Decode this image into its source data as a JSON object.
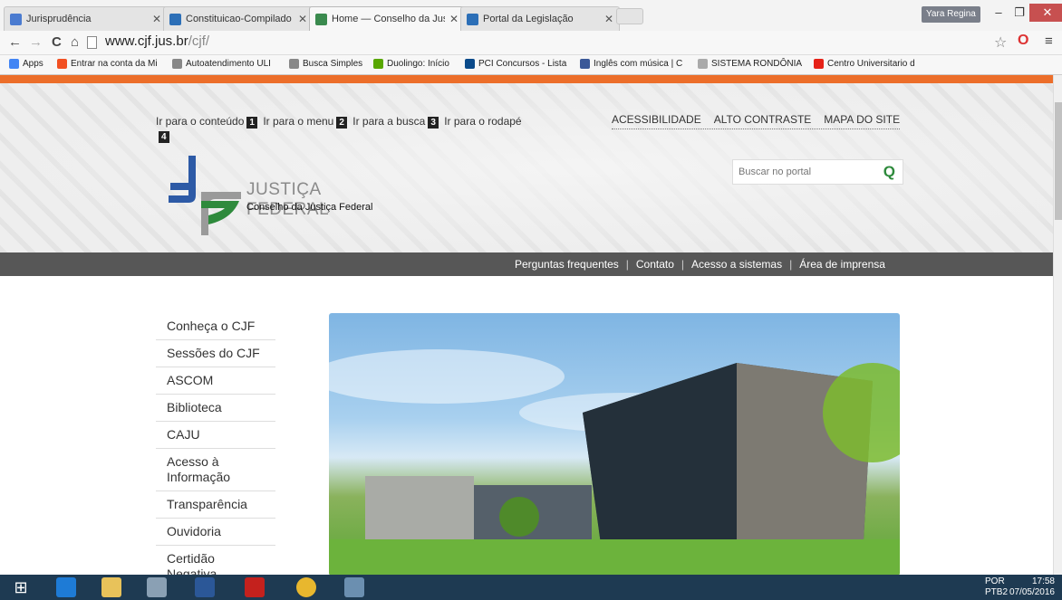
{
  "browser": {
    "tabs": [
      {
        "title": "Jurisprudência",
        "active": false,
        "color": "#4a7bd0"
      },
      {
        "title": "Constituicao-Compilado",
        "active": false,
        "color": "#2c6fb7"
      },
      {
        "title": "Home — Conselho da Jus",
        "active": true,
        "color": "#3a8a4e"
      },
      {
        "title": "Portal da Legislação",
        "active": false,
        "color": "#2c6fb7"
      }
    ],
    "user": "Yara Regina",
    "url_host": "www.cjf.jus.br",
    "url_path": "/cjf/",
    "bookmarks": [
      {
        "label": "Apps",
        "color": "#4285f4"
      },
      {
        "label": "Entrar na conta da Mi",
        "color": "#f25022"
      },
      {
        "label": "Autoatendimento ULI",
        "color": "#888888"
      },
      {
        "label": "Busca Simples",
        "color": "#888888"
      },
      {
        "label": "Duolingo: Início",
        "color": "#58a700"
      },
      {
        "label": "PCI Concursos - Lista",
        "color": "#0a4a8a"
      },
      {
        "label": "Inglês com música | C",
        "color": "#3b5998"
      },
      {
        "label": "SISTEMA RONDÔNIA",
        "color": "#aaaaaa"
      },
      {
        "label": "Centro Universitario d",
        "color": "#e62117"
      }
    ]
  },
  "page": {
    "skip": {
      "a": "Ir para o conteúdo",
      "ak": "1",
      "b": "Ir para o menu",
      "bk": "2",
      "c": "Ir para a busca",
      "ck": "3",
      "d": "Ir para o rodapé",
      "dk": "4"
    },
    "toplinks": [
      "ACESSIBILIDADE",
      "ALTO CONTRASTE",
      "MAPA DO SITE"
    ],
    "search_placeholder": "Buscar no portal",
    "brand": "JUSTIÇA FEDERAL",
    "brand_sub": "Conselho da Justiça Federal",
    "nav": [
      "Perguntas frequentes",
      "Contato",
      "Acesso a sistemas",
      "Área de imprensa"
    ],
    "menu": [
      "Conheça o CJF",
      "Sessões do CJF",
      "ASCOM",
      "Biblioteca",
      "CAJU",
      "Acesso à Informação",
      "Transparência",
      "Ouvidoria",
      "Certidão Negativa"
    ]
  },
  "taskbar": {
    "lang1": "POR",
    "lang2": "PTB2",
    "time": "17:58",
    "date": "07/05/2016"
  }
}
